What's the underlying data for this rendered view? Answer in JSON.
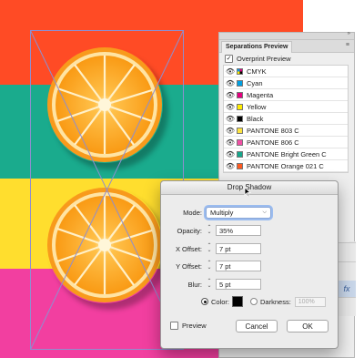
{
  "artboard": {
    "stripes": [
      "#ff4b25",
      "#1aab8d",
      "#ffde2e",
      "#f23fa0"
    ]
  },
  "separations_panel": {
    "tab_label": "Separations Preview",
    "overprint_label": "Overprint Preview",
    "collapse_glyph": "»",
    "menu_glyph": "≡",
    "rows": [
      {
        "name": "CMYK",
        "color": "multicolor"
      },
      {
        "name": "Cyan",
        "color": "#00a0e3"
      },
      {
        "name": "Magenta",
        "color": "#e4007f"
      },
      {
        "name": "Yellow",
        "color": "#ffec00"
      },
      {
        "name": "Black",
        "color": "#000000"
      },
      {
        "name": "PANTONE 803 C",
        "color": "#fde43f"
      },
      {
        "name": "PANTONE 806 C",
        "color": "#f24fa5"
      },
      {
        "name": "PANTONE Bright Green C",
        "color": "#14a78c"
      },
      {
        "name": "PANTONE Orange 021 C",
        "color": "#ff5a20"
      }
    ]
  },
  "side_strip": {
    "fx_label": "fx"
  },
  "dialog": {
    "title": "Drop Shadow",
    "mode_label": "Mode:",
    "mode_value": "Multiply",
    "opacity_label": "Opacity:",
    "opacity_value": "35%",
    "xoffset_label": "X Offset:",
    "xoffset_value": "7 pt",
    "yoffset_label": "Y Offset:",
    "yoffset_value": "7 pt",
    "blur_label": "Blur:",
    "blur_value": "5 pt",
    "color_label": "Color:",
    "darkness_label": "Darkness:",
    "darkness_value": "100%",
    "preview_label": "Preview",
    "cancel_label": "Cancel",
    "ok_label": "OK"
  }
}
